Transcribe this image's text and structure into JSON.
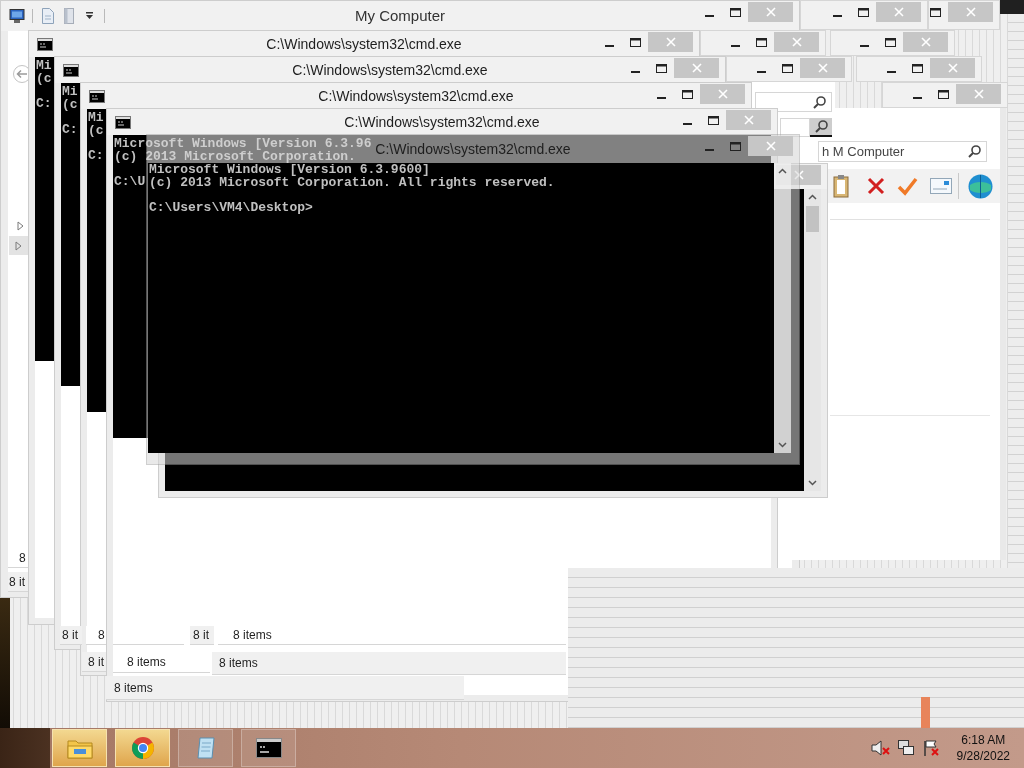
{
  "explorer": {
    "title": "My Computer",
    "search_placeholder": "h M Computer"
  },
  "cmd_windows": [
    {
      "title": "C:\\Windows\\system32\\cmd.exe",
      "banner": [
        "Mi",
        "(c"
      ],
      "prompt": "C:",
      "transparent": false
    },
    {
      "title": "C:\\Windows\\system32\\cmd.exe",
      "banner": [
        "Mi",
        "(c"
      ],
      "prompt": "C:",
      "transparent": false
    },
    {
      "title": "C:\\Windows\\system32\\cmd.exe",
      "banner": [
        "Mi",
        "(c"
      ],
      "prompt": "C:",
      "transparent": false
    },
    {
      "title": "C:\\Windows\\system32\\cmd.exe",
      "banner": [
        "Microsoft Windows [Version 6.3.96",
        "(c) 2013 Microsoft Corporation."
      ],
      "prompt": "C:\\U",
      "transparent": false
    },
    {
      "title": "C:\\Windows\\system32\\cmd.exe",
      "banner": [
        "Microsoft Windows [Version 6.3.9600]",
        "(c) 2013 Microsoft Corporation. All rights reserved."
      ],
      "prompt": "C:\\Users\\VM4\\Desktop>",
      "transparent": true
    }
  ],
  "status_fragments": [
    "8",
    "8 it",
    "8 it",
    "8",
    "8 it",
    "8 items",
    "8 it",
    "8 items",
    "8 items",
    "8 items"
  ],
  "taskbar": {
    "buttons": [
      {
        "kind": "folder",
        "highlighted": true
      },
      {
        "kind": "browser",
        "highlighted": true
      },
      {
        "kind": "notepad",
        "highlighted": false
      },
      {
        "kind": "console",
        "highlighted": false
      }
    ],
    "tray": {
      "sound_muted": true,
      "flag_alert": true
    },
    "clock": {
      "time": "6:18 AM",
      "date": "9/28/2022"
    }
  }
}
